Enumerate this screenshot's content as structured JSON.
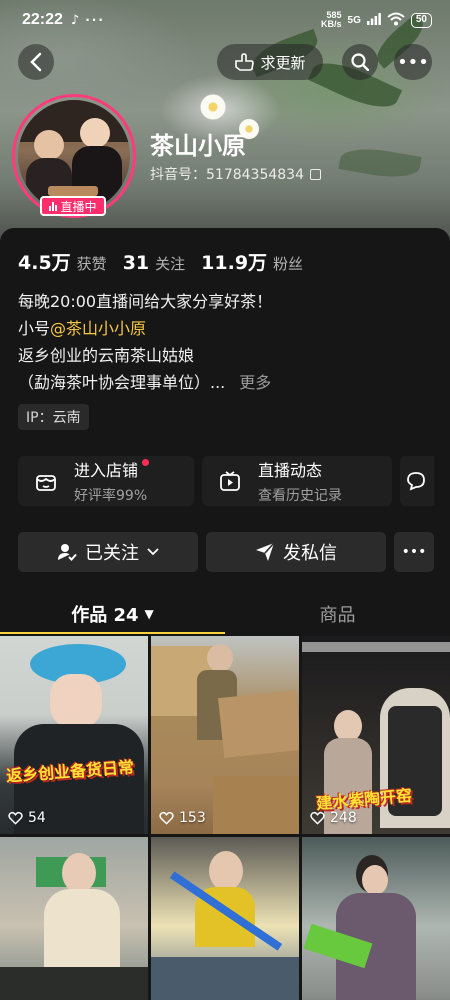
{
  "status_bar": {
    "time": "22:22",
    "net_speed_value": "585",
    "net_speed_unit": "KB/s",
    "signal": "5G",
    "battery": "50"
  },
  "header": {
    "update_label": "求更新"
  },
  "profile": {
    "name": "茶山小原",
    "douyin_id": "抖音号：51784354834",
    "live_badge": "直播中"
  },
  "stats": [
    {
      "value": "4.5万",
      "label": "获赞"
    },
    {
      "value": "31",
      "label": "关注"
    },
    {
      "value": "11.9万",
      "label": "粉丝"
    }
  ],
  "bio": {
    "line1": "每晚20:00直播间给大家分享好茶！",
    "line2_prefix": "小号",
    "line2_mention": "@茶山小小原",
    "line3": "返乡创业的云南茶山姑娘",
    "line4": "（勐海茶叶协会理事单位）...",
    "more": "更多"
  },
  "ip": "IP：云南",
  "cards": [
    {
      "title": "进入店铺",
      "subtitle": "好评率99%",
      "icon": "store-icon"
    },
    {
      "title": "直播动态",
      "subtitle": "查看历史记录",
      "icon": "tv-icon"
    }
  ],
  "actions": {
    "followed": "已关注",
    "message": "发私信"
  },
  "tabs": {
    "works": "作品 24",
    "products": "商品"
  },
  "videos": [
    {
      "likes": "54",
      "caption": "返乡创业备货日常"
    },
    {
      "likes": "153",
      "caption": ""
    },
    {
      "likes": "248",
      "caption": "建水紫陶开窑"
    },
    {
      "likes": "",
      "caption": ""
    },
    {
      "likes": "",
      "caption": ""
    },
    {
      "likes": "",
      "caption": ""
    }
  ],
  "colors": {
    "accent_yellow": "#ffd23b",
    "live_pink": "#ff2d6b",
    "mention": "#f7c842",
    "background": "#161616"
  }
}
